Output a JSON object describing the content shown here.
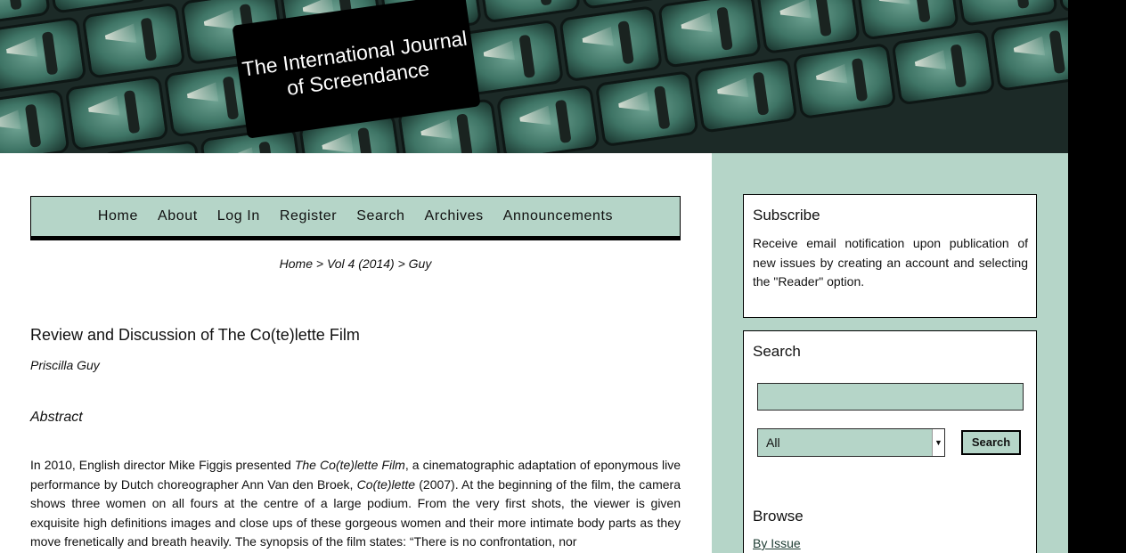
{
  "header": {
    "title_line1": "The International Journal",
    "title_line2": "of Screendance"
  },
  "nav": {
    "items": [
      "Home",
      "About",
      "Log In",
      "Register",
      "Search",
      "Archives",
      "Announcements"
    ]
  },
  "breadcrumb": "Home > Vol 4 (2014) > Guy",
  "article": {
    "title": "Review and Discussion of The Co(te)lette Film",
    "author": "Priscilla Guy",
    "abstract_heading": "Abstract",
    "abstract_p1": "In 2010, English director Mike Figgis presented ",
    "abstract_i1": "The Co(te)lette Film",
    "abstract_p2": ", a cinematographic adaptation of eponymous live performance by Dutch choreographer Ann Van den Broek, ",
    "abstract_i2": "Co(te)lette",
    "abstract_p3": " (2007). At the beginning of the film, the camera shows three women on all fours at the centre of a large podium. From the very first shots, the viewer is given exquisite high definitions images and close ups of these gorgeous women and their more intimate body parts as they move frenetically and breath heavily. The synopsis of the film states: “There is no confrontation, nor"
  },
  "sidebar": {
    "subscribe_title": "Subscribe",
    "subscribe_text": "Receive email notification upon publication of new issues by creating an account and selecting the \"Reader\" option.",
    "search_title": "Search",
    "search_value": "",
    "scope_selected": "All",
    "search_button": "Search",
    "browse_title": "Browse",
    "browse_link": "By Issue"
  },
  "colors": {
    "accent": "#b5d5c8",
    "banner_dark": "#1c2a27",
    "tile_green": "#3f7566"
  }
}
